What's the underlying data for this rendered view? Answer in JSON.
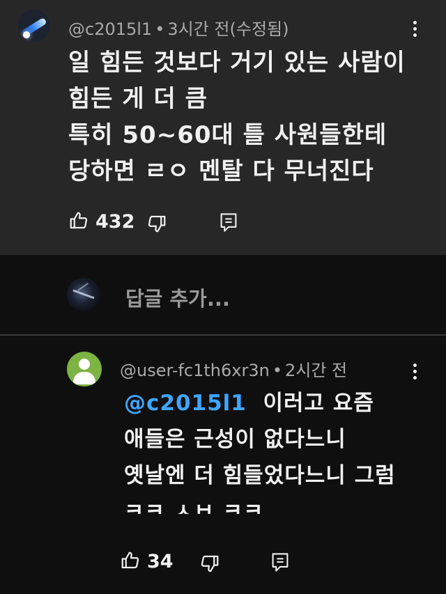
{
  "top_comment": {
    "handle": "@c2015l1",
    "dot": "•",
    "time": "3시간 전(수정됨)",
    "lines": [
      "일 힘든 것보다 거기 있는 사람이",
      "힘든 게 더 큼",
      "특히 50~60대 틀 사원들한테",
      "당하면 ㄹㅇ 멘탈 다 무너진다"
    ],
    "like_count": "432"
  },
  "reply_input": {
    "placeholder": "답글 추가..."
  },
  "reply": {
    "handle": "@user-fc1th6xr3n",
    "dot": "•",
    "time": "2시간 전",
    "mention": "@c2015l1",
    "first_line_rest": "이러고 요즘",
    "lines": [
      "애들은 근성이 없다느니",
      "옛날엔 더 힘들었다느니 그럼",
      "ㅋㅋ ㅅㅂ ㅋㅋ"
    ],
    "like_count": "34"
  },
  "colors": {
    "top_comment_bg": "#272727",
    "page_bg": "#0f0f0f",
    "meta_text": "#aaaaaa",
    "mention": "#3ea6ff",
    "reply_avatar": "#7cb342"
  }
}
